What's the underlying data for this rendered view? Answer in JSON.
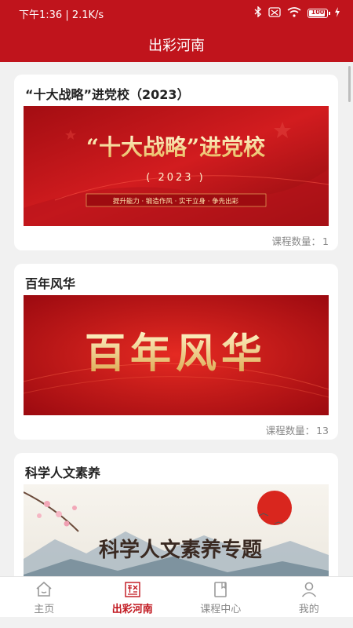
{
  "status_bar": {
    "left_text": "下午1:36 | 2.1K/s",
    "battery": "100"
  },
  "header": {
    "title": "出彩河南"
  },
  "cards": [
    {
      "title": "“十大战略”进党校（2023）",
      "banner": {
        "headline": "“十大战略”进党校",
        "year": "( 2023 )",
        "slogan": "提升能力 · 锻造作风 · 实干立身 · 争先出彩"
      },
      "count_label": "课程数量：",
      "count_value": "1"
    },
    {
      "title": "百年风华",
      "banner": {
        "headline": "百年风华"
      },
      "count_label": "课程数量：",
      "count_value": "13"
    },
    {
      "title": "科学人文素养",
      "banner": {
        "headline": "科学人文素养专题"
      }
    }
  ],
  "tabs": [
    {
      "label": "主页",
      "icon": "home-icon",
      "active": false
    },
    {
      "label": "出彩河南",
      "icon": "chucai-logo-icon",
      "active": true
    },
    {
      "label": "课程中心",
      "icon": "book-icon",
      "active": false
    },
    {
      "label": "我的",
      "icon": "user-icon",
      "active": false
    }
  ],
  "colors": {
    "brand_red": "#c0141c",
    "active_tab": "#c0141c",
    "inactive_tab": "#888888"
  }
}
